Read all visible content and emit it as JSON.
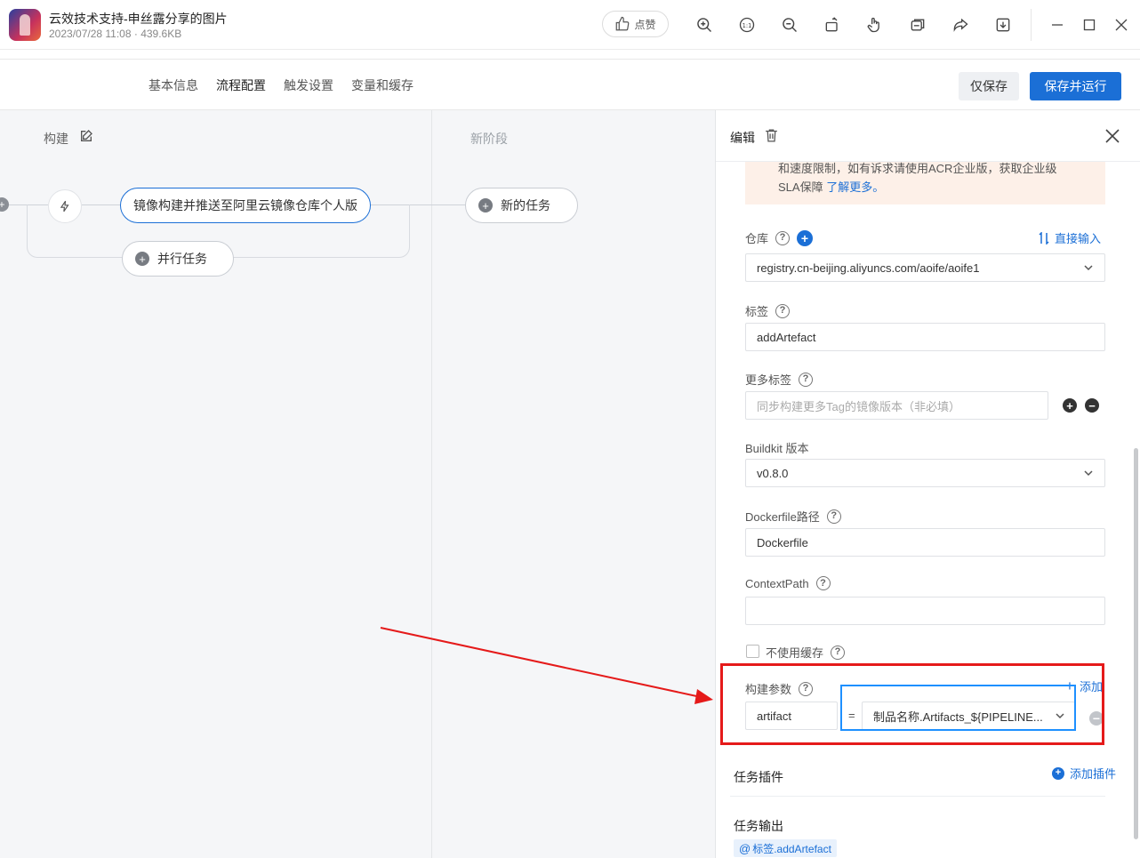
{
  "viewer": {
    "title": "云效技术支持-申丝露分享的图片",
    "meta": "2023/07/28 11:08 · 439.6KB",
    "like_label": "点赞",
    "toolbar_icons": [
      "zoom-in-icon",
      "fit-icon",
      "zoom-out-icon",
      "rotate-icon",
      "hand-icon",
      "copy-icon",
      "share-icon",
      "download-icon"
    ],
    "window_controls": [
      "minimize-icon",
      "maximize-icon",
      "close-icon"
    ]
  },
  "tabs": [
    {
      "label": "基本信息",
      "active": false
    },
    {
      "label": "流程配置",
      "active": true
    },
    {
      "label": "触发设置",
      "active": false
    },
    {
      "label": "变量和缓存",
      "active": false
    }
  ],
  "actions": {
    "save_only": "仅保存",
    "save_and_run": "保存并运行"
  },
  "canvas": {
    "stage1_title": "构建",
    "stage2_title": "新阶段",
    "job_name": "镜像构建并推送至阿里云镜像仓库个人版",
    "parallel_task": "并行任务",
    "new_task": "新的任务"
  },
  "panel": {
    "title": "编辑",
    "notice_line1": "和速度限制，如有诉求请使用ACR企业版，获取企业级",
    "notice_line2_prefix": "SLA保障 ",
    "notice_link": "了解更多。",
    "repo": {
      "label": "仓库",
      "direct_input": "直接输入",
      "value": "registry.cn-beijing.aliyuncs.com/aoife/aoife1"
    },
    "tag": {
      "label": "标签",
      "value": "addArtefact"
    },
    "more_tags": {
      "label": "更多标签",
      "placeholder": "同步构建更多Tag的镜像版本（非必填）"
    },
    "buildkit": {
      "label": "Buildkit 版本",
      "value": "v0.8.0"
    },
    "dockerfile": {
      "label": "Dockerfile路径",
      "value": "Dockerfile"
    },
    "context_path": {
      "label": "ContextPath",
      "value": ""
    },
    "no_cache": {
      "label": "不使用缓存",
      "checked": false
    },
    "build_args": {
      "label": "构建参数",
      "add": "添加",
      "key": "artifact",
      "eq": "=",
      "value": "制品名称.Artifacts_${PIPELINE..."
    },
    "plugins": {
      "title": "任务插件",
      "add": "添加插件"
    },
    "outputs": {
      "title": "任务输出",
      "chip": "标签.addArtefact"
    }
  },
  "colors": {
    "primary": "#1b6fd6",
    "annotation_red": "#e51a1a",
    "annotation_blue": "#1e90ff",
    "notice_bg": "#fdf0e8"
  }
}
